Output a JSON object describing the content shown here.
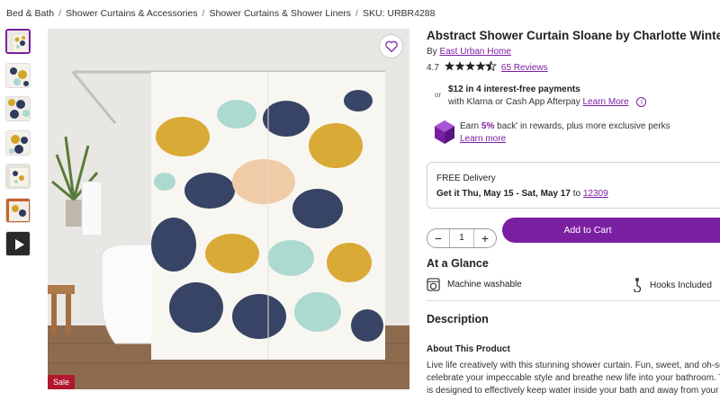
{
  "breadcrumb": {
    "items": [
      "Bed & Bath",
      "Shower Curtains & Accessories",
      "Shower Curtains & Shower Liners"
    ],
    "sku": "SKU: URBR4288"
  },
  "gallery": {
    "thumbnail_count": 7,
    "sale_badge": "Sale",
    "favorite_icon": "heart-icon",
    "video_icon": "play-icon"
  },
  "product": {
    "title": "Abstract Shower Curtain Sloane by Charlotte Winter",
    "by_label": "By",
    "brand": "East Urban Home",
    "rating_value": "4.7",
    "rating_stars": 4.5,
    "reviews_link": "65 Reviews"
  },
  "payments": {
    "or_label": "or",
    "headline": "$12 in 4 interest-free payments",
    "subtext": "with Klarna or Cash App Afterpay",
    "learn_more": "Learn More"
  },
  "rewards": {
    "text_before": "Earn",
    "percent": "5%",
    "text_after": "back' in rewards, plus more exclusive perks",
    "learn_more": "Learn more",
    "accent": "#7b1fa2"
  },
  "delivery": {
    "label": "FREE Delivery",
    "date_range": "Get it Thu, May 15 - Sat, May 17",
    "to_label": "to",
    "zip": "12309"
  },
  "purchase": {
    "quantity": "1",
    "minus": "−",
    "plus": "+",
    "add_to_cart": "Add to Cart",
    "button_color": "#7b1fa2"
  },
  "glance": {
    "heading": "At a Glance",
    "features": [
      "Machine washable",
      "Hooks Included"
    ]
  },
  "description": {
    "heading": "Description",
    "about_heading": "About This Product",
    "lines": [
      "Live life creatively with this stunning shower curtain. Fun, sweet, and oh-so-ch",
      "celebrate your impeccable style and breathe new life into your bathroom. Thi",
      "is designed to effectively keep water inside your bath and away from your flo"
    ]
  }
}
